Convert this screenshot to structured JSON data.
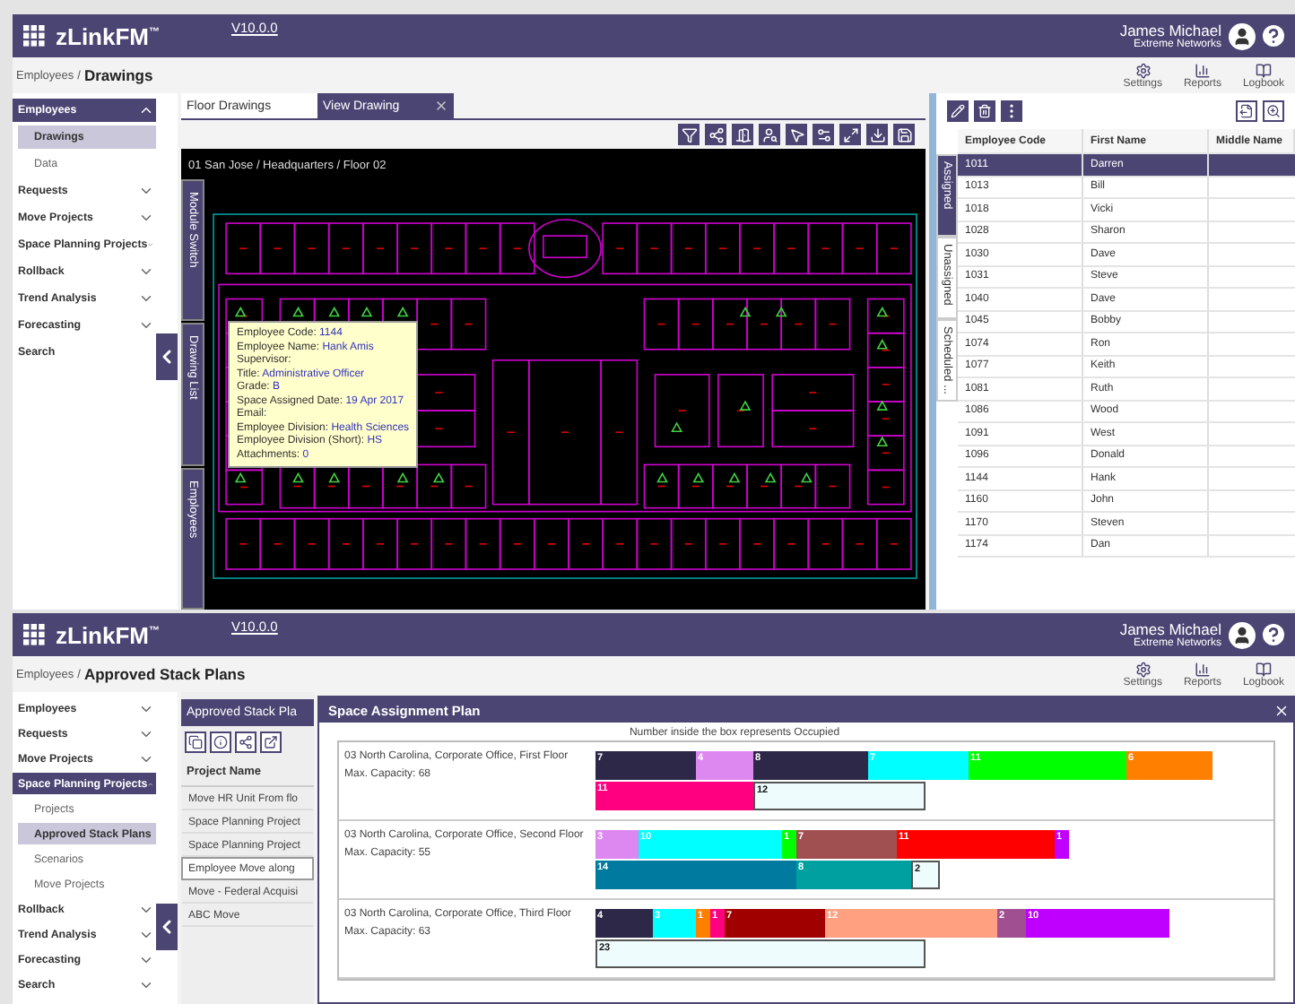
{
  "drawings_screen": {
    "header": {
      "logo": "zLinkFM$^{™}$",
      "version": "V10.0.0",
      "user_name": "James Michael",
      "organization": "Extreme Networks",
      "tools": [
        {
          "kind": "settings",
          "label": "Settings"
        },
        {
          "kind": "reports",
          "label": "Reports"
        },
        {
          "kind": "logbook",
          "label": "Logbook"
        }
      ]
    },
    "breadcrumb": {
      "parent": "Employees",
      "separator": "/",
      "current": "Drawings"
    },
    "sidebar": {
      "items": [
        {
          "kind": "group",
          "label": "Employees",
          "expanded": true,
          "children": [
            {
              "label": "Drawings",
              "selected": true
            },
            {
              "label": "Data",
              "selected": false
            }
          ]
        },
        {
          "kind": "group",
          "label": "Requests",
          "expanded": false
        },
        {
          "kind": "group",
          "label": "Move Projects",
          "expanded": false
        },
        {
          "kind": "group",
          "label": "Space Planning Projects",
          "expanded": false
        },
        {
          "kind": "group",
          "label": "Rollback",
          "expanded": false
        },
        {
          "kind": "group",
          "label": "Trend Analysis",
          "expanded": false
        },
        {
          "kind": "group",
          "label": "Forecasting",
          "expanded": false
        },
        {
          "kind": "link",
          "label": "Search"
        }
      ]
    },
    "tabs": [
      {
        "label": "Floor Drawings",
        "selected": false,
        "closable": false
      },
      {
        "label": "View Drawing",
        "selected": true,
        "closable": true
      }
    ],
    "drawing": {
      "title": "01 San Jose / Headquarters / Floor 02",
      "side_tabs": [
        "Module Switch",
        "Drawing List",
        "Employees"
      ],
      "tooltip": [
        {
          "label": "Employee Code:",
          "value": "1144"
        },
        {
          "label": "Employee Name:",
          "value": "Hank Amis"
        },
        {
          "label": "Supervisor:"
        },
        {
          "label": "Title:",
          "value": "Administrative Officer"
        },
        {
          "label": "Grade:",
          "value": "B"
        },
        {
          "label": "Space Assigned Date:",
          "value": "19 Apr 2017"
        },
        {
          "label": "Email:"
        },
        {
          "label": "Employee Division:",
          "value": "Health Sciences"
        },
        {
          "label": "Employee Division (Short):",
          "value": "HS"
        },
        {
          "label": "Attachments:",
          "value": "0"
        }
      ]
    },
    "employee_panel": {
      "tabs": [
        {
          "label": "Assigned",
          "selected": true
        },
        {
          "label": "Unassigned",
          "selected": false
        },
        {
          "label": "Scheduled ...",
          "selected": false
        }
      ],
      "columns": [
        "Employee Code",
        "First Name",
        "Middle Name"
      ],
      "rows": [
        {
          "cells": [
            "1011",
            "Darren"
          ],
          "selected": true
        },
        {
          "cells": [
            "1013",
            "Bill"
          ],
          "selected": false
        },
        {
          "cells": [
            "1018",
            "Vicki"
          ],
          "selected": false
        },
        {
          "cells": [
            "1028",
            "Sharon"
          ],
          "selected": false
        },
        {
          "cells": [
            "1030",
            "Dave"
          ],
          "selected": false
        },
        {
          "cells": [
            "1031",
            "Steve"
          ],
          "selected": false
        },
        {
          "cells": [
            "1040",
            "Dave"
          ],
          "selected": false
        },
        {
          "cells": [
            "1045",
            "Bobby"
          ],
          "selected": false
        },
        {
          "cells": [
            "1074",
            "Ron"
          ],
          "selected": false
        },
        {
          "cells": [
            "1077",
            "Keith"
          ],
          "selected": false
        },
        {
          "cells": [
            "1081",
            "Ruth"
          ],
          "selected": false
        },
        {
          "cells": [
            "1086",
            "Wood"
          ],
          "selected": false
        },
        {
          "cells": [
            "1091",
            "West"
          ],
          "selected": false
        },
        {
          "cells": [
            "1096",
            "Donald"
          ],
          "selected": false
        },
        {
          "cells": [
            "1144",
            "Hank"
          ],
          "selected": false
        },
        {
          "cells": [
            "1160",
            "John"
          ],
          "selected": false
        },
        {
          "cells": [
            "1170",
            "Steven"
          ],
          "selected": false
        },
        {
          "cells": [
            "1174",
            "Dan"
          ],
          "selected": false
        }
      ]
    }
  },
  "stack_plans_screen": {
    "header": {
      "logo": "zLinkFM$^{™}$",
      "version": "V10.0.0",
      "user_name": "James Michael",
      "organization": "Extreme Networks",
      "tools": [
        {
          "kind": "settings",
          "label": "Settings"
        },
        {
          "kind": "reports",
          "label": "Reports"
        },
        {
          "kind": "logbook",
          "label": "Logbook"
        }
      ]
    },
    "breadcrumb": {
      "parent": "Employees",
      "separator": "/",
      "current": "Approved Stack Plans"
    },
    "sidebar": {
      "items": [
        {
          "kind": "group",
          "label": "Employees",
          "expanded": false
        },
        {
          "kind": "group",
          "label": "Requests",
          "expanded": false
        },
        {
          "kind": "group",
          "label": "Move Projects",
          "expanded": false
        },
        {
          "kind": "group",
          "label": "Space Planning Projects",
          "expanded": true,
          "children": [
            {
              "label": "Projects",
              "selected": false
            },
            {
              "label": "Approved Stack Plans",
              "selected": true
            },
            {
              "label": "Scenarios",
              "selected": false
            },
            {
              "label": "Move Projects",
              "selected": false
            }
          ]
        },
        {
          "kind": "group",
          "label": "Rollback",
          "expanded": false
        },
        {
          "kind": "group",
          "label": "Trend Analysis",
          "expanded": false
        },
        {
          "kind": "group",
          "label": "Forecasting",
          "expanded": false
        },
        {
          "kind": "group",
          "label": "Search",
          "expanded": false
        }
      ]
    },
    "project_panel": {
      "title": "Approved Stack Pla",
      "column": "Project Name",
      "rows": [
        {
          "name": "Move HR Unit From flo",
          "selected": false
        },
        {
          "name": "Space Planning Project",
          "selected": false
        },
        {
          "name": "Space Planning Project",
          "selected": false
        },
        {
          "name": "Employee Move along",
          "selected": true
        },
        {
          "name": "Move - Federal Acquisi",
          "selected": false
        },
        {
          "name": "ABC Move",
          "selected": false
        }
      ]
    },
    "dialog": {
      "title": "Space Assignment Plan",
      "caption": "Number inside the box represents Occupied",
      "floors": [
        {
          "name": "03 North Carolina, Corporate Office, First Floor",
          "capacity": "Max. Capacity: 68",
          "bars": [
            {
              "segments": [
                {
                  "label": "7",
                  "color": "#2e2848"
                },
                {
                  "label": "4",
                  "color": "#dd88f0"
                },
                {
                  "label": "8",
                  "color": "#2e2848"
                },
                {
                  "label": "7",
                  "color": "#00ffff"
                },
                {
                  "label": "11",
                  "color": "#00ff00"
                },
                {
                  "label": "6",
                  "color": "#ff8000"
                }
              ]
            },
            {
              "segments": [
                {
                  "label": "11",
                  "color": "#ff0080"
                },
                {
                  "label": "12",
                  "color": "#eefcfd"
                }
              ]
            }
          ]
        },
        {
          "name": "03 North Carolina, Corporate Office, Second Floor",
          "capacity": "Max. Capacity: 55",
          "bars": [
            {
              "segments": [
                {
                  "label": "3",
                  "color": "#dd88f0"
                },
                {
                  "label": "10",
                  "color": "#00ffff"
                },
                {
                  "label": "1",
                  "color": "#00ff00"
                },
                {
                  "label": "7",
                  "color": "#a05050"
                },
                {
                  "label": "11",
                  "color": "#ff0000"
                },
                {
                  "label": "1",
                  "color": "#c000ff"
                }
              ]
            },
            {
              "segments": [
                {
                  "label": "14",
                  "color": "#007a9e"
                },
                {
                  "label": "8",
                  "color": "#00a0a0"
                },
                {
                  "label": "2",
                  "color": "#eefcfd"
                }
              ]
            }
          ]
        },
        {
          "name": "03 North Carolina, Corporate Office, Third Floor",
          "capacity": "Max. Capacity: 63",
          "bars": [
            {
              "segments": [
                {
                  "label": "4",
                  "color": "#2e2848"
                },
                {
                  "label": "3",
                  "color": "#00ffff"
                },
                {
                  "label": "1",
                  "color": "#ff8000"
                },
                {
                  "label": "1",
                  "color": "#ff0080"
                },
                {
                  "label": "7",
                  "color": "#a00000"
                },
                {
                  "label": "12",
                  "color": "#ffa080"
                },
                {
                  "label": "2",
                  "color": "#a05090"
                },
                {
                  "label": "10",
                  "color": "#c000ff"
                }
              ]
            },
            {
              "segments": [
                {
                  "label": "23",
                  "color": "#eefcfd"
                }
              ]
            }
          ]
        }
      ]
    }
  }
}
